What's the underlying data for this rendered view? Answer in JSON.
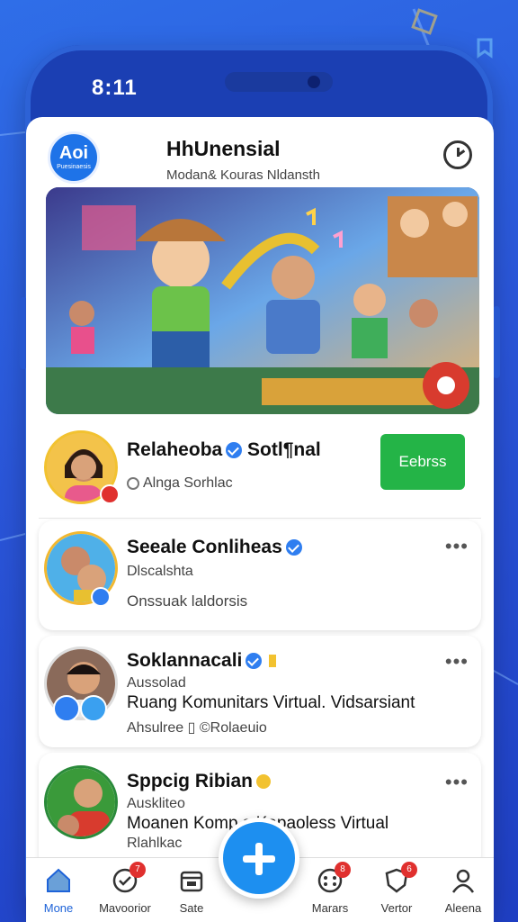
{
  "status_bar": {
    "time": "8:11"
  },
  "header": {
    "logo_main": "Aoi",
    "logo_sub": "Puesinaesis",
    "title": "HhUnensial",
    "subtitle": "Modan& Kouras Nldansth"
  },
  "colors": {
    "accent": "#1e73e8",
    "green": "#24b447",
    "background": "#2a55d8"
  },
  "cards": [
    {
      "name": "Relaheoba",
      "name_suffix": "Sotl¶nal",
      "line1": "Alnga Sorhlac",
      "action_label": "Eebrss"
    },
    {
      "name": "Seeale Conliheas",
      "line1": "Dlscalshta",
      "line2": "Onssuak laldorsis"
    },
    {
      "name": "Soklannacali",
      "line1": "Aussolad",
      "line2": "Ruang Komunitars Virtual. Vidsarsiant",
      "line3": "Ahsulree ▯ ©Rolaeuio"
    },
    {
      "name": "Sppcig Ribian",
      "line1": "Auskliteo",
      "line2": "Moanen Komp    s Kapaoless Virtual",
      "line3": "Rlahlkac"
    }
  ],
  "nav": [
    {
      "label": "Mone",
      "icon": "home-icon",
      "badge": ""
    },
    {
      "label": "Mavoorior",
      "icon": "clock-check-icon",
      "badge": "7"
    },
    {
      "label": "Sate",
      "icon": "calendar-icon",
      "badge": ""
    },
    {
      "label": "Marars",
      "icon": "dots-circle-icon",
      "badge": "8"
    },
    {
      "label": "Vertor",
      "icon": "shield-icon",
      "badge": "6"
    },
    {
      "label": "Aleena",
      "icon": "person-icon",
      "badge": ""
    }
  ],
  "fab": {
    "icon": "plus-icon"
  }
}
